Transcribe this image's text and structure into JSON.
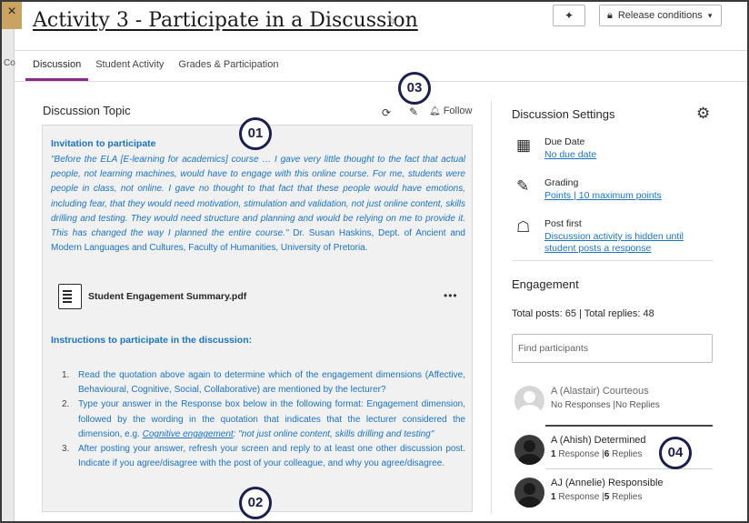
{
  "window": {
    "close_glyph": "×",
    "side_label": "Co"
  },
  "header": {
    "title": "Activity 3 - Participate in a Discussion",
    "release_label": "Release conditions"
  },
  "tabs": [
    {
      "label": "Discussion",
      "active": true
    },
    {
      "label": "Student Activity",
      "active": false
    },
    {
      "label": "Grades & Participation",
      "active": false
    }
  ],
  "callouts": [
    "01",
    "02",
    "03",
    "04"
  ],
  "topic": {
    "heading": "Discussion Topic",
    "follow_label": "Follow",
    "invitation_heading": "Invitation to participate",
    "quote_italic": "\"Before the ELA [E-learning for academics] course … I gave very little thought to the fact that actual people, not learning machines, would have to engage with this online course. For me, students were people in class, not online. I gave no thought to that fact that these people would have emotions, including fear, that they would need motivation, stimulation and validation, not just online content, skills drilling and testing. They would need structure and planning and would be relying on me to provide it. This has changed the way I planned the entire course.\"",
    "quote_attribution": " Dr. Susan Haskins, Dept. of Ancient and Modern Languages and Cultures, Faculty of Humanities, University of Pretoria.",
    "file_name": "Student Engagement Summary.pdf",
    "file_more": "•••",
    "instructions_heading": "Instructions to participate in the discussion:",
    "steps": [
      {
        "num": "1.",
        "text": "Read the quotation above again to determine which of the engagement dimensions (Affective, Behavioural, Cognitive, Social, Collaborative) are mentioned by the lecturer?"
      },
      {
        "num": "2.",
        "text_before": "Type your answer in the Response box below in the following format: Engagement dimension, followed by the wording in the quotation that indicates that the lecturer considered the dimension, e.g. ",
        "link": "Cognitive engagement",
        "text_after": ": \"not just online content, skills drilling and testing\""
      },
      {
        "num": "3.",
        "text": "After posting your answer, refresh your screen and reply to at least one other discussion post. Indicate if you agree/disagree with the post of your colleague, and why you agree/disagree."
      }
    ]
  },
  "settings": {
    "heading": "Discussion Settings",
    "items": [
      {
        "icon": "calendar-icon",
        "label": "Due Date",
        "value": "No due date"
      },
      {
        "icon": "grading-icon",
        "label": "Grading",
        "value": "Points | 10 maximum points"
      },
      {
        "icon": "post-first-icon",
        "label": "Post first",
        "value_line1": "Discussion activity is hidden until",
        "value_line2": "student posts a response"
      }
    ]
  },
  "engagement": {
    "heading": "Engagement",
    "totals": "Total posts: 65 | Total replies: 48",
    "search_placeholder": "Find participants",
    "participants": [
      {
        "name": "A (Alastair) Courteous",
        "responses": "No Responses",
        "replies": "No Replies"
      },
      {
        "name": "A (Ahish) Determined",
        "responses_count": "1",
        "responses_label": " Response",
        "replies_count": "6",
        "replies_label": " Replies"
      },
      {
        "name": "AJ (Annelie) Responsible",
        "responses_count": "1",
        "responses_label": " Response",
        "replies_count": "5",
        "replies_label": " Replies"
      }
    ]
  }
}
